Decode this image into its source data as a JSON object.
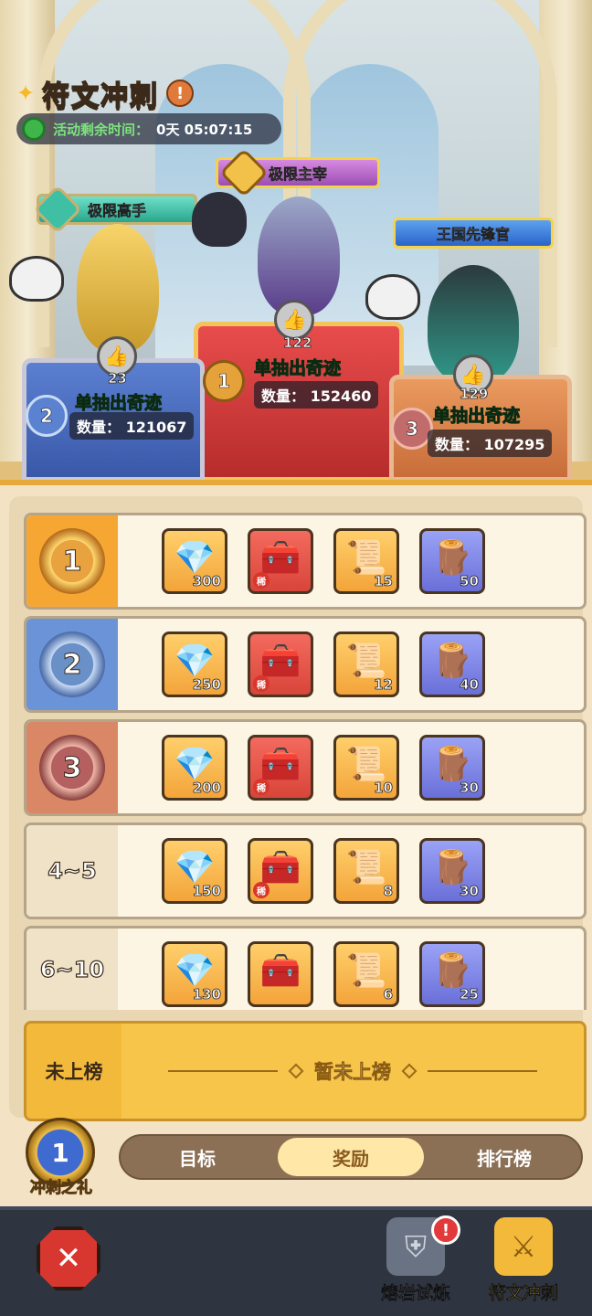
{
  "event": {
    "title": "符文冲刺",
    "timer_label": "活动剩余时间：",
    "timer_value": "0天 05:07:15"
  },
  "podium": [
    {
      "rank": "1",
      "title": "极限主宰",
      "likes": "122",
      "name": "单抽出奇迹",
      "quantity": "数量： 152460"
    },
    {
      "rank": "2",
      "title": "极限高手",
      "likes": "23",
      "name": "单抽出奇迹",
      "quantity": "数量： 121067"
    },
    {
      "rank": "3",
      "title": "王国先锋官",
      "likes": "129",
      "name": "单抽出奇迹",
      "quantity": "数量： 107295"
    }
  ],
  "rewards": [
    {
      "rank": "1",
      "items": [
        {
          "icon": "crystal-icon",
          "count": "300",
          "rare": false
        },
        {
          "icon": "rare-chest-icon",
          "count": "",
          "rare": true
        },
        {
          "icon": "scroll-icon",
          "count": "15",
          "rare": false
        },
        {
          "icon": "rune-stone-icon",
          "count": "50",
          "rare": false
        }
      ]
    },
    {
      "rank": "2",
      "items": [
        {
          "icon": "crystal-icon",
          "count": "250",
          "rare": false
        },
        {
          "icon": "rare-chest-icon",
          "count": "",
          "rare": true
        },
        {
          "icon": "scroll-icon",
          "count": "12",
          "rare": false
        },
        {
          "icon": "rune-stone-icon",
          "count": "40",
          "rare": false
        }
      ]
    },
    {
      "rank": "3",
      "items": [
        {
          "icon": "crystal-icon",
          "count": "200",
          "rare": false
        },
        {
          "icon": "rare-chest-icon",
          "count": "",
          "rare": true
        },
        {
          "icon": "scroll-icon",
          "count": "10",
          "rare": false
        },
        {
          "icon": "rune-stone-icon",
          "count": "30",
          "rare": false
        }
      ]
    },
    {
      "rank": "4~5",
      "items": [
        {
          "icon": "crystal-icon",
          "count": "150",
          "rare": false
        },
        {
          "icon": "gold-chest-icon",
          "count": "",
          "rare": true
        },
        {
          "icon": "scroll-icon",
          "count": "8",
          "rare": false
        },
        {
          "icon": "rune-stone-icon",
          "count": "30",
          "rare": false
        }
      ]
    },
    {
      "rank": "6~10",
      "items": [
        {
          "icon": "crystal-icon",
          "count": "130",
          "rare": false
        },
        {
          "icon": "gold-chest-icon",
          "count": "",
          "rare": false
        },
        {
          "icon": "scroll-icon",
          "count": "6",
          "rare": false
        },
        {
          "icon": "rune-stone-icon",
          "count": "25",
          "rare": false
        }
      ]
    }
  ],
  "rare_tag": "稀",
  "unranked": {
    "label": "未上榜",
    "status": "暂未上榜"
  },
  "gift": {
    "label": "冲刺之礼",
    "badge": "1"
  },
  "tabs": [
    "目标",
    "奖励",
    "排行榜"
  ],
  "active_tab": "奖励",
  "bottom_nav": {
    "items": [
      {
        "label": "熔岩试炼",
        "alert": "!"
      },
      {
        "label": "符文冲刺"
      }
    ]
  },
  "colors": {
    "accent": "#f6a733",
    "alert": "#e23a3a",
    "green_name": "#2ce06e"
  }
}
